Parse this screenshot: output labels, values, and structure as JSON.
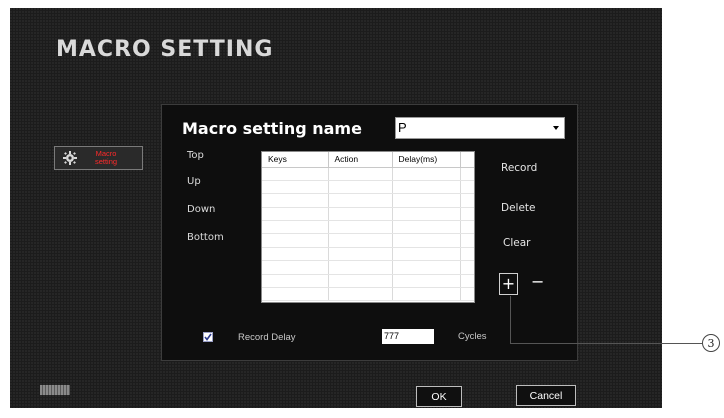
{
  "window": {
    "title": "MACRO SETTING"
  },
  "sidebar": {
    "macro_button": {
      "icon": "gear-icon",
      "label": "Macro setting"
    }
  },
  "macro": {
    "name_label": "Macro setting name",
    "name_value": "P"
  },
  "positions": [
    "Top",
    "Up",
    "Down",
    "Bottom"
  ],
  "table": {
    "columns": [
      "Keys",
      "Action",
      "Delay(ms)"
    ],
    "rows": []
  },
  "actions": {
    "record": "Record",
    "delete": "Delete",
    "clear": "Clear",
    "add": "+",
    "remove": "−"
  },
  "options": {
    "record_delay_label": "Record Delay",
    "record_delay_checked": true,
    "cycles_value": "777",
    "cycles_label": "Cycles"
  },
  "footer": {
    "ok": "OK",
    "cancel": "Cancel"
  },
  "callout": {
    "number": "3"
  },
  "colors": {
    "background": "#1c1c1c",
    "panel": "#0e0e0e",
    "accent_red": "#ff2a2a",
    "text": "#ffffff"
  }
}
